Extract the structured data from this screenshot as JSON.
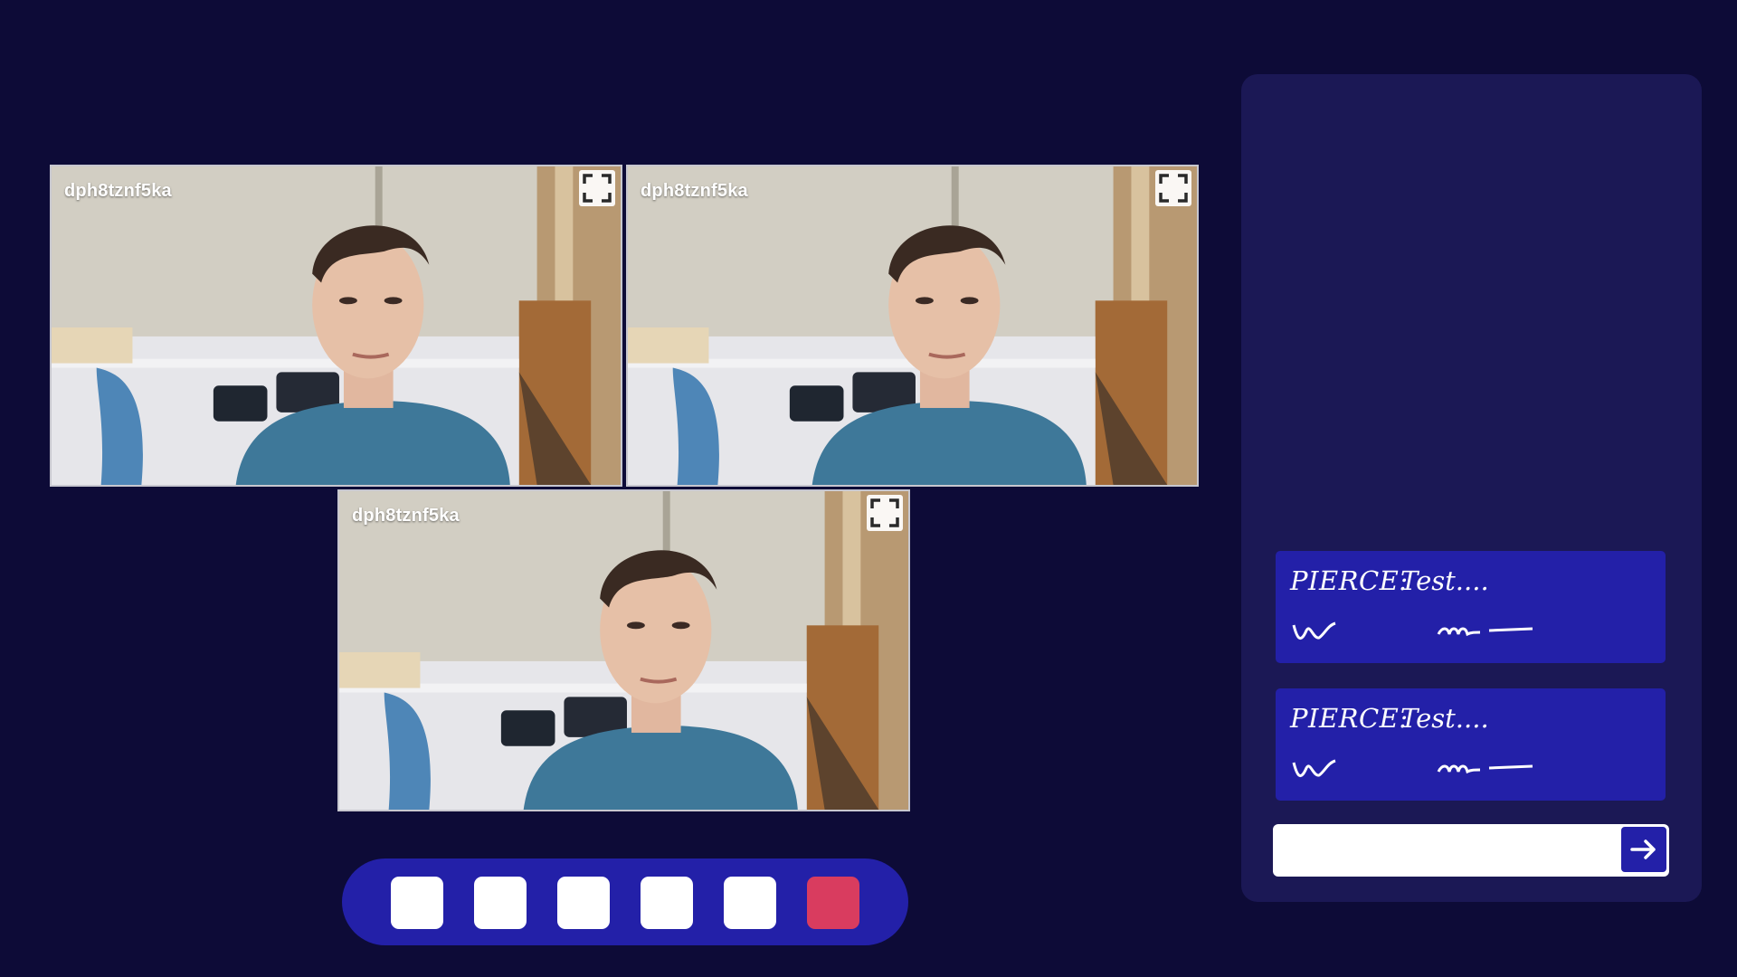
{
  "videos": [
    {
      "participant": "dph8tznf5ka",
      "fullscreen_icon": "fullscreen-icon"
    },
    {
      "participant": "dph8tznf5ka",
      "fullscreen_icon": "fullscreen-icon"
    },
    {
      "participant": "dph8tznf5ka",
      "fullscreen_icon": "fullscreen-icon"
    }
  ],
  "controls": {
    "buttons": [
      {
        "name": "control-button-1",
        "color": "#ffffff"
      },
      {
        "name": "control-button-2",
        "color": "#ffffff"
      },
      {
        "name": "control-button-3",
        "color": "#ffffff"
      },
      {
        "name": "control-button-4",
        "color": "#ffffff"
      },
      {
        "name": "control-button-5",
        "color": "#ffffff"
      },
      {
        "name": "leave-call-button",
        "color": "#d93c5f"
      }
    ],
    "bar_color": "#2320a8"
  },
  "chat": {
    "messages": [
      {
        "author": "PIERCE:",
        "text": "Test...."
      },
      {
        "author": "PIERCE:",
        "text": "Test...."
      }
    ],
    "input": {
      "value": "",
      "placeholder": ""
    },
    "send_icon": "arrow-right-icon"
  },
  "colors": {
    "background": "#0d0b37",
    "panel": "#1b1855",
    "accent": "#2320a8",
    "danger": "#d93c5f"
  }
}
